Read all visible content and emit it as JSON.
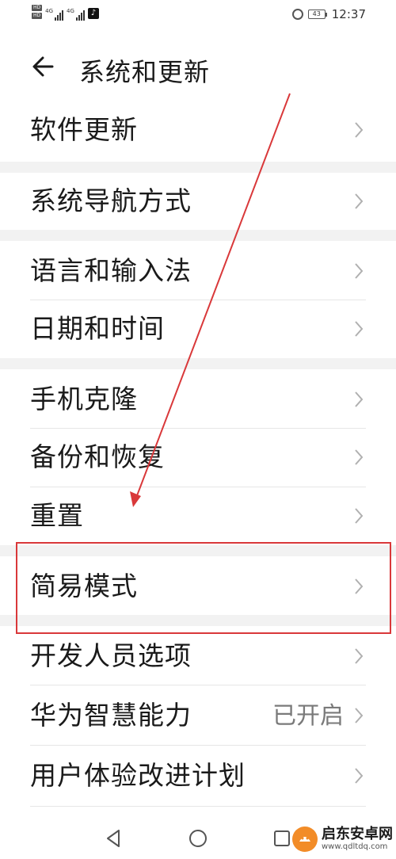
{
  "status_bar": {
    "hd_badge": "HD",
    "sim1_network": "4G",
    "sim2_network": "4G",
    "battery_level": "43",
    "time": "12:37"
  },
  "header": {
    "title": "系统和更新"
  },
  "menu": {
    "group1": [
      {
        "label": "软件更新"
      }
    ],
    "group2": [
      {
        "label": "系统导航方式"
      }
    ],
    "group3": [
      {
        "label": "语言和输入法"
      },
      {
        "label": "日期和时间"
      }
    ],
    "group4": [
      {
        "label": "手机克隆"
      },
      {
        "label": "备份和恢复"
      },
      {
        "label": "重置"
      }
    ],
    "group5": [
      {
        "label": "简易模式"
      }
    ],
    "group6": [
      {
        "label": "开发人员选项"
      },
      {
        "label": "华为智慧能力",
        "value": "已开启"
      },
      {
        "label": "用户体验改进计划"
      }
    ]
  },
  "watermark": {
    "title": "启东安卓网",
    "url": "www.qdltdq.com"
  },
  "colors": {
    "highlight": "#d9383a",
    "divider": "#e6e6e6",
    "section_gap": "#f2f2f2"
  }
}
